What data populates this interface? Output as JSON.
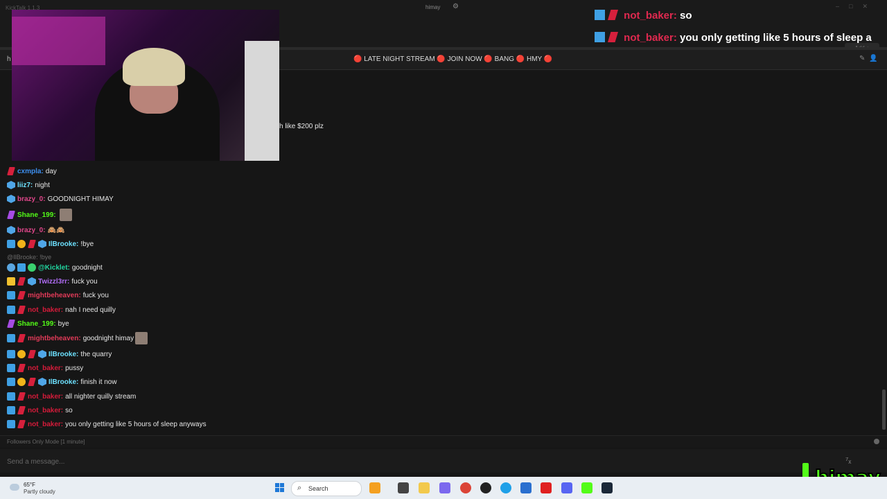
{
  "window": {
    "app_title": "KickTalk 1.1.3",
    "tab_label": "himay",
    "add_label": "Add +"
  },
  "channel": {
    "title": "🔴 LATE NIGHT STREAM 🔴 JOIN NOW 🔴 BANG 🔴 HMY 🔴",
    "left_label": "h"
  },
  "overlay": [
    {
      "user": "not_baker:",
      "text": "so"
    },
    {
      "user": "not_baker:",
      "text": "you only getting like 5 hours of sleep a"
    }
  ],
  "partial_text": "h like $200 plz",
  "chat": {
    "reply_text": "@IlBrooke: !bye",
    "messages": [
      {
        "user": "cxmpla:",
        "text": "day"
      },
      {
        "user": "liiz7:",
        "text": "night"
      },
      {
        "user": "brazy_0:",
        "text": "GOODNIGHT HIMAY"
      },
      {
        "user": "Shane_199:",
        "text": ""
      },
      {
        "user": "brazy_0:",
        "text": ""
      },
      {
        "user": "IlBrooke:",
        "text": "!bye"
      },
      {
        "user": "@Kicklet:",
        "text": "goodnight"
      },
      {
        "user": "Twizzl3rr:",
        "text": "fuck you"
      },
      {
        "user": "mightbeheaven:",
        "text": "fuck you"
      },
      {
        "user": "not_baker:",
        "text": "nah I need quilly"
      },
      {
        "user": "Shane_199:",
        "text": "bye"
      },
      {
        "user": "mightbeheaven:",
        "text": "goodnight himay"
      },
      {
        "user": "IlBrooke:",
        "text": "the quarry"
      },
      {
        "user": "not_baker:",
        "text": "pussy"
      },
      {
        "user": "IlBrooke:",
        "text": "finish it now"
      },
      {
        "user": "not_baker:",
        "text": "all nighter quilly stream"
      },
      {
        "user": "not_baker:",
        "text": "so"
      },
      {
        "user": "not_baker:",
        "text": "you only getting like 5 hours of sleep anyways"
      }
    ]
  },
  "followers_mode": "Followers Only Mode [1 minute]",
  "input": {
    "placeholder": "Send a message..."
  },
  "logo_text": "himay",
  "taskbar": {
    "temp": "65°F",
    "condition": "Partly cloudy",
    "search_label": "Search"
  },
  "colors": {
    "kick_green": "#53fc18",
    "not_baker_red": "#d61b3a"
  }
}
